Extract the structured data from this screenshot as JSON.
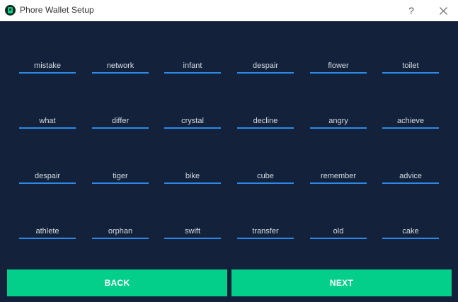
{
  "window": {
    "title": "Phore Wallet Setup",
    "help_label": "?"
  },
  "words": [
    [
      "mistake",
      "network",
      "infant",
      "despair",
      "flower",
      "toilet"
    ],
    [
      "what",
      "differ",
      "crystal",
      "decline",
      "angry",
      "achieve"
    ],
    [
      "despair",
      "tiger",
      "bike",
      "cube",
      "remember",
      "advice"
    ],
    [
      "athlete",
      "orphan",
      "swift",
      "transfer",
      "old",
      "cake"
    ]
  ],
  "buttons": {
    "back": "BACK",
    "next": "NEXT"
  },
  "colors": {
    "background": "#13213a",
    "accent": "#03cf8b",
    "underline": "#2b8ae8"
  }
}
